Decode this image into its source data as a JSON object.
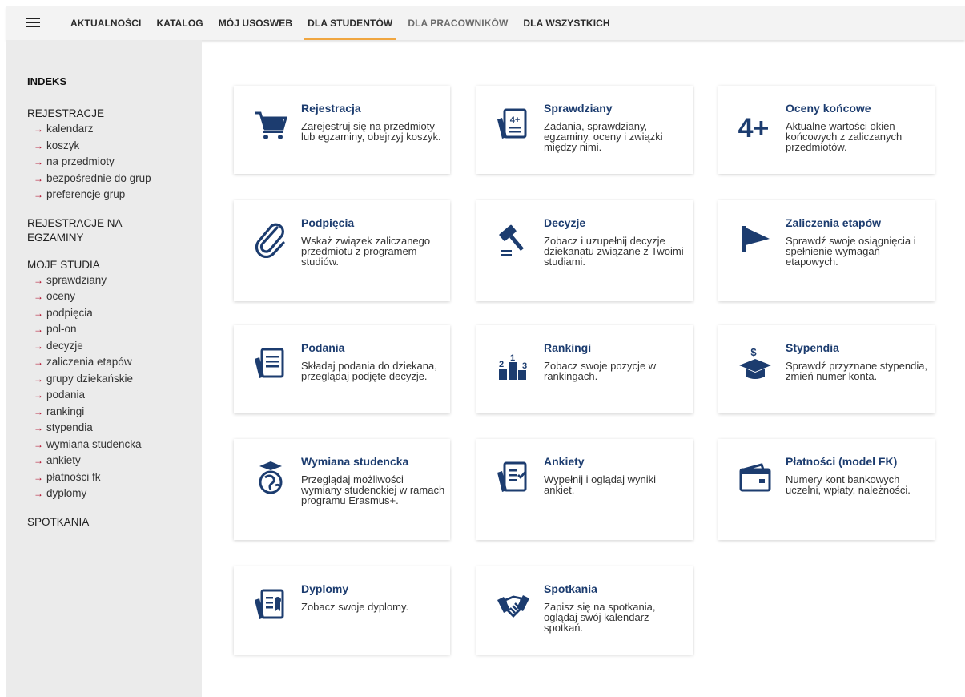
{
  "nav": {
    "items": [
      {
        "label": "AKTUALNOŚCI"
      },
      {
        "label": "KATALOG"
      },
      {
        "label": "MÓJ USOSWEB"
      },
      {
        "label": "DLA STUDENTÓW"
      },
      {
        "label": "DLA PRACOWNIKÓW"
      },
      {
        "label": "DLA WSZYSTKICH"
      }
    ],
    "active": "DLA STUDENTÓW",
    "accent_color": "#f0a640"
  },
  "sidebar": {
    "heading": "INDEKS",
    "sections": [
      {
        "label": "REJESTRACJE",
        "items": [
          "kalendarz",
          "koszyk",
          "na przedmioty",
          "bezpośrednie do grup",
          "preferencje grup"
        ]
      },
      {
        "label": "REJESTRACJE NA EGZAMINY",
        "items": []
      },
      {
        "label": "MOJE STUDIA",
        "items": [
          "sprawdziany",
          "oceny",
          "podpięcia",
          "pol-on",
          "decyzje",
          "zaliczenia etapów",
          "grupy dziekańskie",
          "podania",
          "rankingi",
          "stypendia",
          "wymiana studencka",
          "ankiety",
          "płatności fk",
          "dyplomy"
        ]
      },
      {
        "label": "SPOTKANIA",
        "items": []
      }
    ],
    "arrow_glyph": "→",
    "arrow_color": "#b00020"
  },
  "cards": [
    {
      "title": "Rejestracja",
      "desc": "Zarejestruj się na przedmioty lub egzaminy, obejrzyj koszyk.",
      "icon": "cart-icon"
    },
    {
      "title": "Sprawdziany",
      "desc": "Zadania, sprawdziany, egzaminy, oceny i związki między nimi.",
      "icon": "test-sheet-icon",
      "icon_text": "4+"
    },
    {
      "title": "Oceny końcowe",
      "desc": "Aktualne wartości okien końcowych z zaliczanych przedmiotów.",
      "icon": "grade-icon",
      "icon_text": "4+"
    },
    {
      "title": "Podpięcia",
      "desc": "Wskaż związek zaliczanego przedmiotu z programem studiów.",
      "icon": "paperclip-icon"
    },
    {
      "title": "Decyzje",
      "desc": "Zobacz i uzupełnij decyzje dziekanatu związane z Twoimi studiami.",
      "icon": "gavel-icon"
    },
    {
      "title": "Zaliczenia etapów",
      "desc": "Sprawdź swoje osiągnięcia i spełnienie wymagań etapowych.",
      "icon": "flag-icon"
    },
    {
      "title": "Podania",
      "desc": "Składaj podania do dziekana, przeglądaj podjęte decyzje.",
      "icon": "document-icon"
    },
    {
      "title": "Rankingi",
      "desc": "Zobacz swoje pozycje w rankingach.",
      "icon": "podium-icon",
      "icon_text": [
        "2",
        "1",
        "3"
      ]
    },
    {
      "title": "Stypendia",
      "desc": "Sprawdź przyznane stypendia, zmień numer konta.",
      "icon": "graduation-cap-dollar-icon",
      "icon_text": "$"
    },
    {
      "title": "Wymiana studencka",
      "desc": "Przeglądaj możliwości wymiany studenckiej w ramach programu Erasmus+.",
      "icon": "globe-student-icon"
    },
    {
      "title": "Ankiety",
      "desc": "Wypełnij i oglądaj wyniki ankiet.",
      "icon": "survey-icon"
    },
    {
      "title": "Płatności (model FK)",
      "desc": "Numery kont bankowych uczelni, wpłaty, należności.",
      "icon": "wallet-icon"
    },
    {
      "title": "Dyplomy",
      "desc": "Zobacz swoje dyplomy.",
      "icon": "diploma-icon"
    },
    {
      "title": "Spotkania",
      "desc": "Zapisz się na spotkania, oglądaj swój kalendarz spotkań.",
      "icon": "handshake-icon"
    }
  ],
  "colors": {
    "icon": "#1c3c6f",
    "title": "#1c3c6f"
  }
}
